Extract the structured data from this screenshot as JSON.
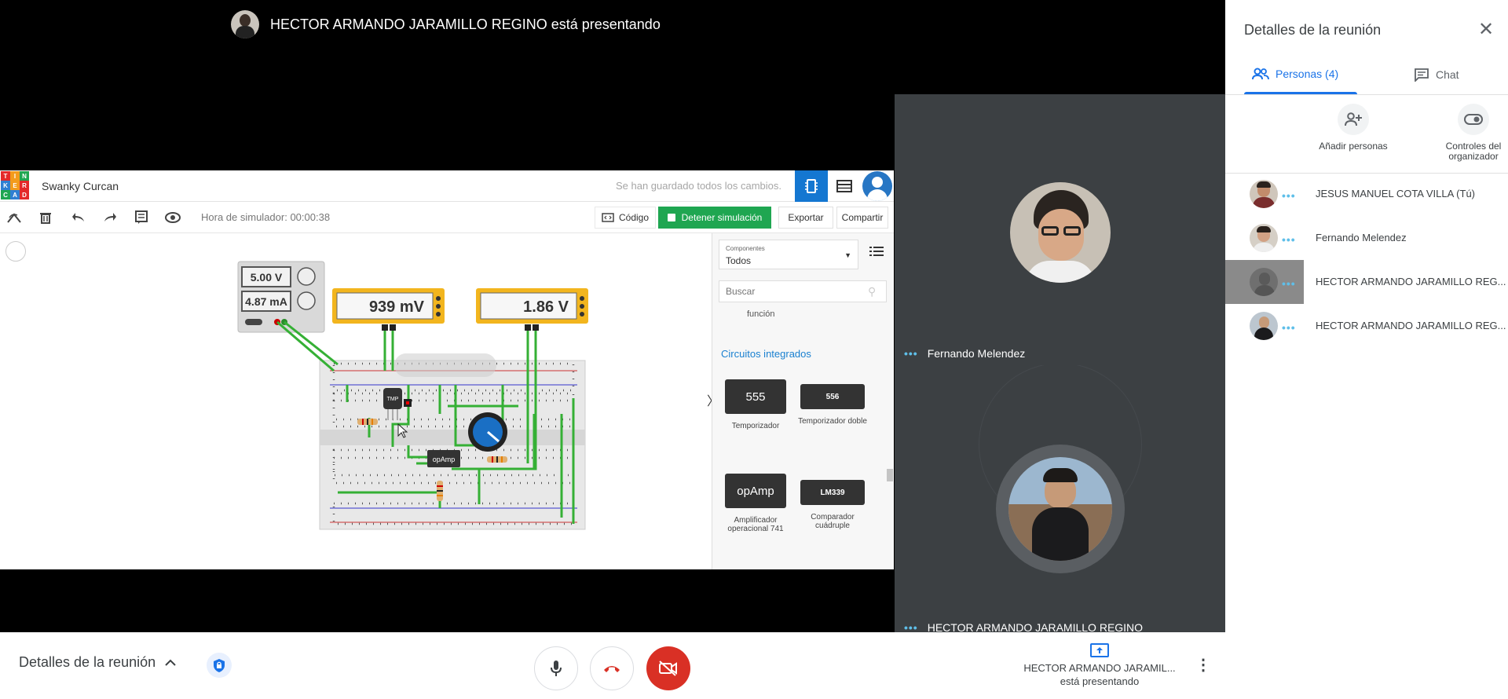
{
  "stage": {
    "presenter_banner": "HECTOR ARMANDO JARAMILLO REGINO está presentando"
  },
  "tinkercad": {
    "logo_letters": [
      "T",
      "I",
      "N",
      "K",
      "E",
      "R",
      "C",
      "A",
      "D"
    ],
    "logo_colors": [
      "#e42929",
      "#f39b1c",
      "#1fa651",
      "#2f7fd2",
      "#f39b1c",
      "#e42929",
      "#1fa651",
      "#2f7fd2",
      "#e42929"
    ],
    "design_title": "Swanky Curcan",
    "save_status": "Se han guardado todos los cambios.",
    "sim_time": "Hora de simulador: 00:00:38",
    "code_label": "Código",
    "stop_label": "Detener simulación",
    "export_label": "Exportar",
    "share_label": "Compartir",
    "power_supply": {
      "voltage": "5.00 V",
      "current": "4.87 mA"
    },
    "multimeters": [
      {
        "reading": "939 mV"
      },
      {
        "reading": "1.86 V"
      }
    ],
    "sensor_label": "TMP",
    "opamp_label": "opAmp",
    "collapse_glyph": "〉",
    "panel": {
      "select_label": "Componentes",
      "select_value": "Todos",
      "search_placeholder": "Buscar",
      "section_fragment": "función",
      "section_title": "Circuitos integrados",
      "components": [
        {
          "chip": "555",
          "name": "Temporizador"
        },
        {
          "chip": "556",
          "name": "Temporizador doble"
        },
        {
          "chip": "opAmp",
          "name": "Amplificador operacional 741"
        },
        {
          "chip": "LM339",
          "name": "Comparador cuádruple"
        }
      ]
    }
  },
  "tiles": [
    {
      "name": "Fernando Melendez"
    },
    {
      "name": "HECTOR ARMANDO JARAMILLO REGINO"
    }
  ],
  "side_panel": {
    "title": "Detalles de la reunión",
    "tab_people": "Personas (4)",
    "tab_chat": "Chat",
    "action_add": "Añadir personas",
    "action_host": "Controles del organizador",
    "people": [
      {
        "name": "JESUS MANUEL COTA VILLA (Tú)"
      },
      {
        "name": "Fernando Melendez"
      },
      {
        "name": "HECTOR ARMANDO JARAMILLO REG..."
      },
      {
        "name": "HECTOR ARMANDO JARAMILLO REG..."
      }
    ]
  },
  "bottom_bar": {
    "details_label": "Detalles de la reunión",
    "presenting_name": "HECTOR ARMANDO JARAMIL...",
    "presenting_status": "está presentando"
  },
  "icons": {
    "close": "close-icon",
    "people": "people-icon",
    "chat": "chat-icon",
    "add_person": "add-person-icon",
    "host_controls": "toggle-icon",
    "mic": "mic-icon",
    "hangup": "hangup-icon",
    "camera_off": "camera-off-icon",
    "present": "present-screen-icon",
    "more": "more-vert-icon",
    "shield": "shield-lock-icon"
  },
  "colors": {
    "accent": "#1a73e8",
    "hangup_red": "#d93025",
    "tinkercad_green": "#1fa651",
    "tinkercad_blue": "#1477d1",
    "active_dots": "#5fbfe9"
  }
}
